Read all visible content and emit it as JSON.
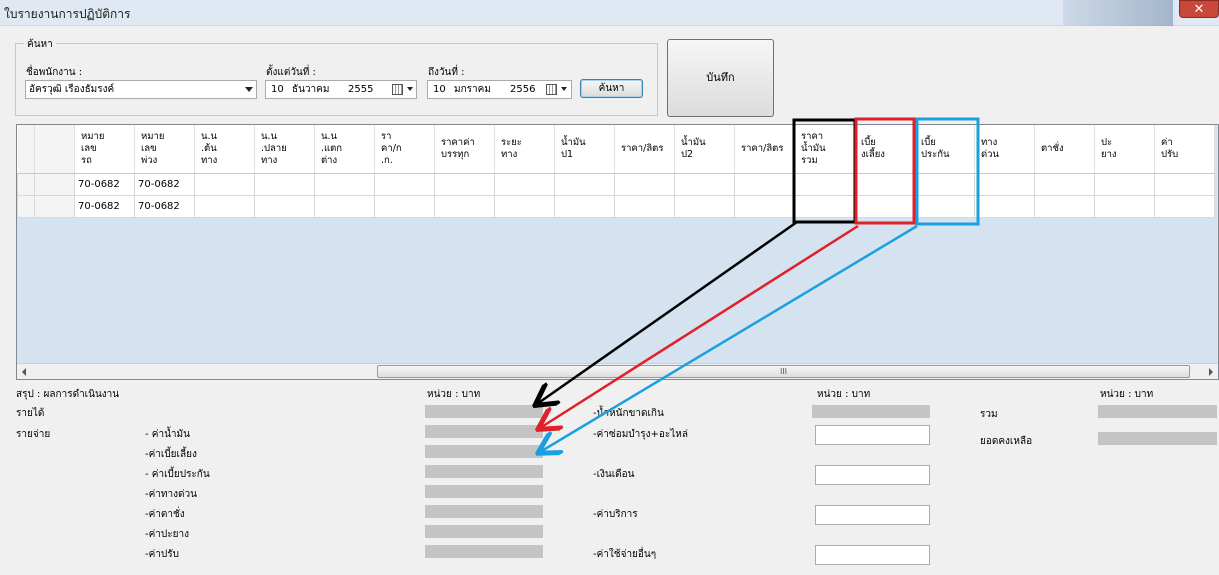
{
  "window": {
    "title": "ใบรายงานการปฏิบัติการ",
    "close_glyph": "✕"
  },
  "search": {
    "group_label": "ค้นหา",
    "employee_label": "ชื่อพนักงาน :",
    "employee_value": "อัครวุฒิ เรืองธัมรงค์",
    "from_label": "ตั้งแต่วันที่ :",
    "from_day": "10",
    "from_month": "ธันวาคม",
    "from_year": "2555",
    "to_label": "ถึงวันที่ :",
    "to_day": "10",
    "to_month": "มกราคม",
    "to_year": "2556",
    "search_button": "ค้นหา"
  },
  "save_button": "บันทึก",
  "grid": {
    "columns": [
      "หมาย\nเลข\nรถ",
      "หมาย\nเลข\nพ่วง",
      "น.น\n.ต้น\nทาง",
      "น.น\n.ปลาย\nทาง",
      "น.น\n.แตก\nต่าง",
      "รา\nคา/ก\n.ก.",
      "ราคาค่า\nบรรทุก",
      "ระยะ\nทาง",
      "น้ำมัน\nป1",
      "ราคา/ลิตร",
      "น้ำมัน\nป2",
      "ราคา/ลิตร",
      "ราคา\nน้ำมัน\nรวม",
      "เบี้ย\nงเลี้ยง",
      "เบี้ย\nประกัน",
      "ทาง\nด่วน",
      "ตาชั่ง",
      "ปะ\nยาง",
      "ค่า\nปรับ"
    ],
    "rows": [
      [
        "70-0682",
        "70-0682"
      ],
      [
        "70-0682",
        "70-0682"
      ]
    ],
    "scroll_glyph": "III"
  },
  "summary": {
    "title": "สรุป : ผลการดำเนินงาน",
    "unit": "หน่วย : บาท",
    "income_label": "รายได้",
    "expense_label": "รายจ่าย",
    "expense_items": [
      "- ค่าน้ำมัน",
      "-ค่าเบี้ยเลี้ยง",
      "- ค่าเบี้ยประกัน",
      "-ค่าทางด่วน",
      "-ค่าตาชั่ง",
      "-ค่าปะยาง",
      "-ค่าปรับ"
    ],
    "mid_items": [
      "-น้ำหนักขาดเกิน",
      "-ค่าซ่อมบำรุง+อะไหล่",
      "-เงินเดือน",
      "-ค่าบริการ",
      "-ค่าใช้จ่ายอื่นๆ"
    ],
    "total_label": "รวม",
    "balance_label": "ยอดคงเหลือ"
  },
  "colors": {
    "annotation_black": "#000000",
    "annotation_red": "#e0202a",
    "annotation_blue": "#1aa0e0"
  }
}
